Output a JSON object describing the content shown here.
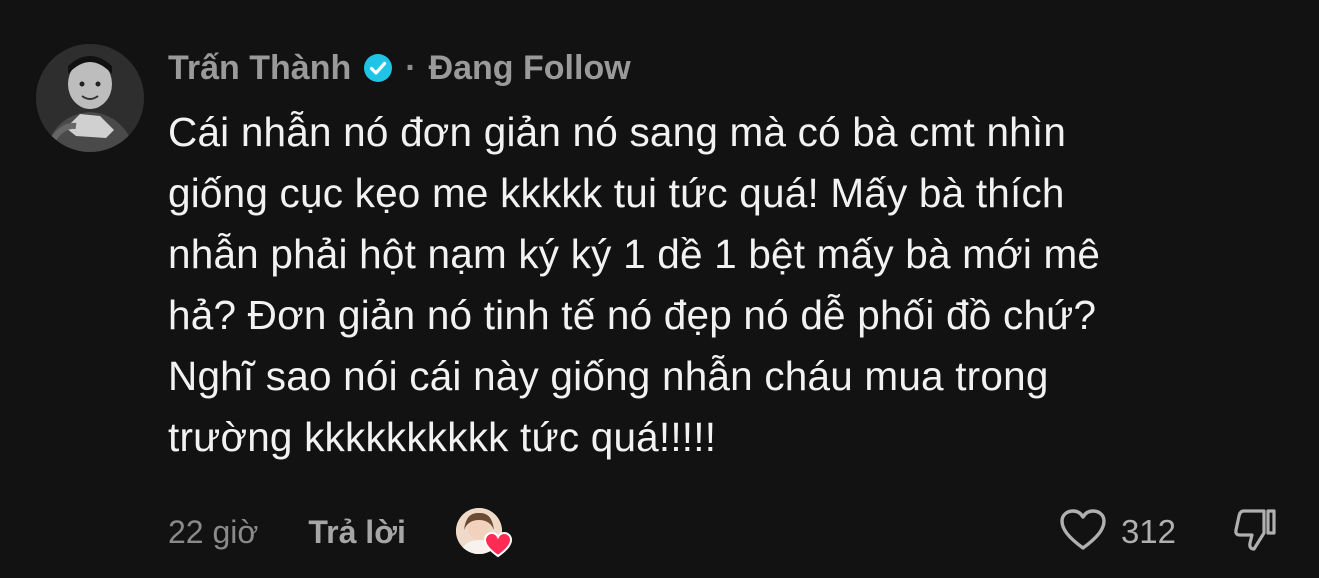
{
  "comment": {
    "author": "Trấn Thành",
    "separator": "·",
    "follow_status": "Đang Follow",
    "text": "Cái nhẫn nó đơn giản nó sang mà có bà cmt nhìn\ngiống cục kẹo me kkkkk tui tức quá! Mấy bà thích\nnhẫn phải hột nạm ký ký 1 dề 1 bệt mấy bà mới mê\nhả? Đơn giản nó tinh tế nó đẹp nó dễ phối đồ chứ?\nNghĩ sao nói cái này giống nhẫn cháu mua trong\ntrường kkkkkkkkkk tức quá!!!!!",
    "time": "22 giờ",
    "reply_label": "Trả lời",
    "like_count": "312"
  },
  "icons": {
    "verified": "verified-badge-icon",
    "like": "heart-outline-icon",
    "dislike": "thumbs-down-icon",
    "creator_like": "creator-liked-heart-icon"
  },
  "colors": {
    "background": "#121212",
    "verified": "#20c4e6",
    "heart_badge": "#fe2c55",
    "muted_text": "#9a9a9a"
  }
}
